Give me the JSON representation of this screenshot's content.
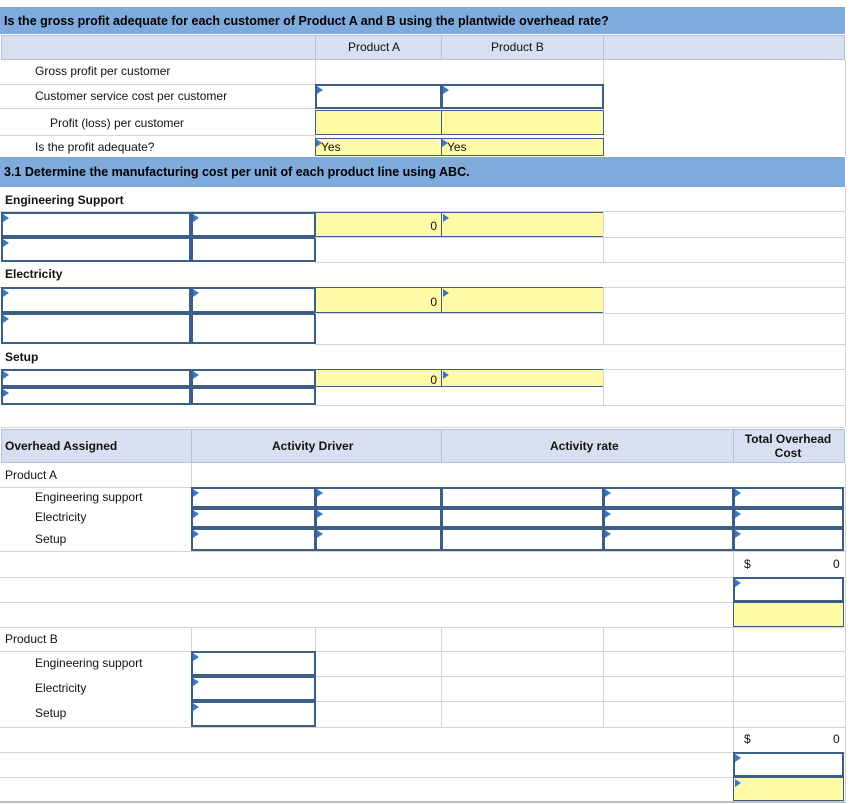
{
  "question_bar": "Is the gross profit adequate for each customer of Product A and B using the plantwide overhead rate?",
  "columns": {
    "product_a": "Product A",
    "product_b": "Product B"
  },
  "profit_rows": {
    "gross_profit": "Gross profit per customer",
    "service_cost": "Customer service cost per customer",
    "profit_loss": "Profit (loss) per customer",
    "adequate": "Is the profit adequate?"
  },
  "adequate_values": {
    "product_a": "Yes",
    "product_b": "Yes"
  },
  "section_31": "3.1 Determine the manufacturing cost per unit of each product line using ABC.",
  "pools": {
    "engineering": {
      "label": "Engineering Support",
      "total": "0"
    },
    "electricity": {
      "label": "Electricity",
      "total": "0"
    },
    "setup": {
      "label": "Setup",
      "total": "0"
    }
  },
  "assign_header": {
    "overhead_assigned": "Overhead Assigned",
    "activity_driver": "Activity Driver",
    "activity_rate": "Activity rate",
    "total_overhead_cost": "Total Overhead Cost"
  },
  "product_a_block": {
    "label": "Product A",
    "rows": [
      "Engineering support",
      "Electricity",
      "Setup"
    ],
    "currency": "$",
    "total": "0"
  },
  "product_b_block": {
    "label": "Product B",
    "rows": [
      "Engineering support",
      "Electricity",
      "Setup"
    ],
    "currency": "$",
    "total": "0"
  },
  "colors": {
    "title_bar": "#7eaadc",
    "header_band": "#d8dff0",
    "input_border": "#3d5f87",
    "yellow": "#fffaa6",
    "flag": "#3a78c4"
  }
}
